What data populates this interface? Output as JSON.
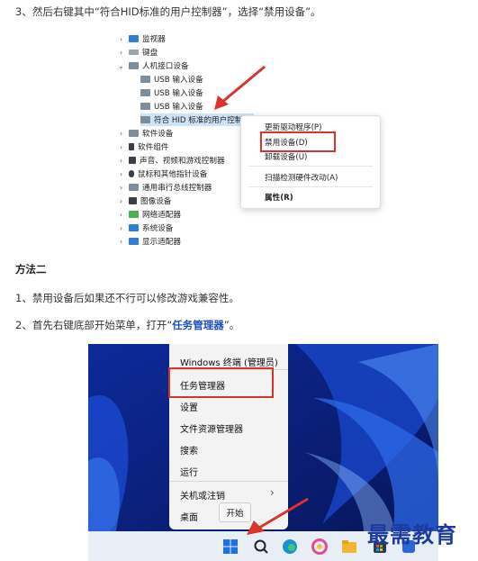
{
  "steps": {
    "step3": "3、然后右键其中“符合HID标准的用户控制器”，选择“禁用设备”。",
    "method2": "方法二",
    "note1": "1、禁用设备后如果还不行可以修改游戏兼容性。",
    "step2_prefix": "2、首先右键底部开始菜单，打开“",
    "step2_highlight": "任务管理器",
    "step2_suffix": "”。"
  },
  "device_tree": {
    "items": [
      {
        "label": "监视器",
        "chevron": "›",
        "icon": "monitor-icon"
      },
      {
        "label": "键盘",
        "chevron": "›",
        "icon": "keyboard-icon"
      },
      {
        "label": "人机接口设备",
        "chevron": "⌄",
        "icon": "hid-icon"
      },
      {
        "label": "USB 输入设备",
        "chevron": "",
        "icon": "usb-device-icon"
      },
      {
        "label": "USB 输入设备",
        "chevron": "",
        "icon": "usb-device-icon"
      },
      {
        "label": "USB 输入设备",
        "chevron": "",
        "icon": "usb-device-icon"
      },
      {
        "label": "符合 HID 标准的用户控制设",
        "chevron": "",
        "icon": "hid-device-icon"
      },
      {
        "label": "软件设备",
        "chevron": "›",
        "icon": "software-device-icon"
      },
      {
        "label": "软件组件",
        "chevron": "›",
        "icon": "software-component-icon"
      },
      {
        "label": "声音、视频和游戏控制器",
        "chevron": "›",
        "icon": "sound-icon"
      },
      {
        "label": "鼠标和其他指针设备",
        "chevron": "›",
        "icon": "mouse-icon"
      },
      {
        "label": "通用串行总线控制器",
        "chevron": "›",
        "icon": "usb-controller-icon"
      },
      {
        "label": "图像设备",
        "chevron": "›",
        "icon": "camera-icon"
      },
      {
        "label": "网络适配器",
        "chevron": "›",
        "icon": "network-icon"
      },
      {
        "label": "系统设备",
        "chevron": "›",
        "icon": "system-icon"
      },
      {
        "label": "显示适配器",
        "chevron": "›",
        "icon": "display-adapter-icon"
      }
    ]
  },
  "context_menu": {
    "update_driver": "更新驱动程序(P)",
    "disable_device": "禁用设备(D)",
    "uninstall_device": "卸载设备(U)",
    "scan_hardware": "扫描检测硬件改动(A)",
    "properties": "属性(R)"
  },
  "win_menu": {
    "terminal_admin": "Windows 终端 (管理员)",
    "task_manager": "任务管理器",
    "settings": "设置",
    "file_explorer": "文件资源管理器",
    "search": "搜索",
    "run": "运行",
    "shutdown": "关机或注销",
    "shutdown_chevron": "›",
    "desktop": "桌面"
  },
  "tooltip": "开始",
  "watermark": "最需教育",
  "colors": {
    "highlight": "#1a4fc0",
    "red_annotation": "#d9342b",
    "wallpaper": "#0a1a6e",
    "watermark": "#1d3a9e"
  }
}
